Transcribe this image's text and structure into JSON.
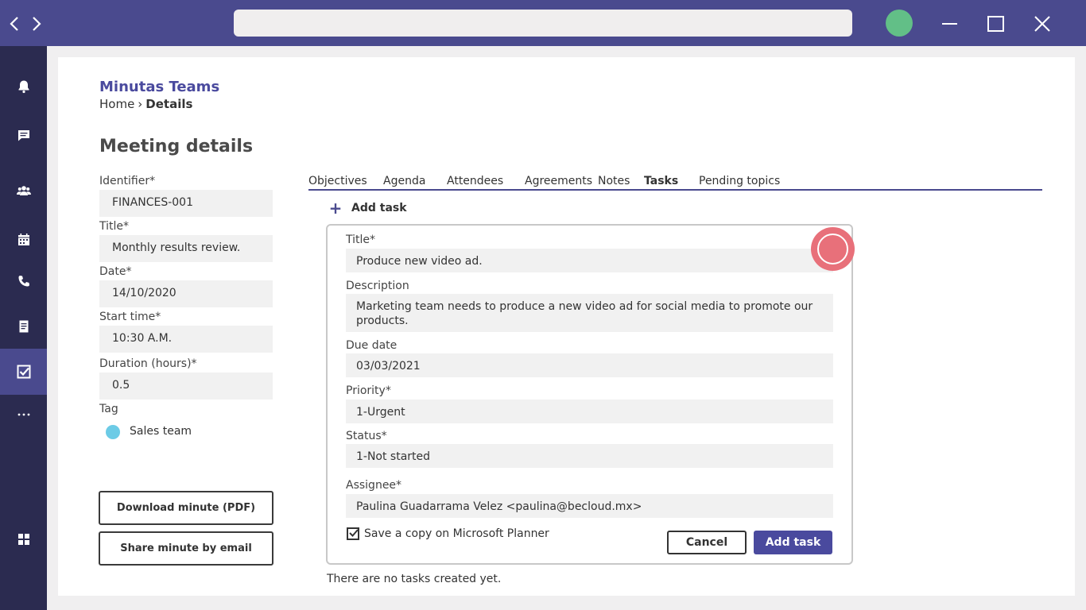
{
  "topbar": {
    "back_icon": "chevron-left-icon",
    "forward_icon": "chevron-right-icon",
    "address_value": "",
    "avatar_color": "#62bf87",
    "window_icons": [
      "minimize-icon",
      "maximize-icon",
      "close-icon"
    ]
  },
  "sidebar": {
    "items": [
      {
        "icon": "bell-icon",
        "active": false
      },
      {
        "icon": "chat-icon",
        "active": false
      },
      {
        "icon": "people-icon",
        "active": false
      },
      {
        "icon": "calendar-icon",
        "active": false
      },
      {
        "icon": "phone-icon",
        "active": false
      },
      {
        "icon": "document-icon",
        "active": false
      },
      {
        "icon": "tasks-check-icon",
        "active": true
      },
      {
        "icon": "more-icon",
        "active": false
      },
      {
        "icon": "apps-grid-icon",
        "active": false
      }
    ]
  },
  "header": {
    "app_title": "Minutas Teams",
    "breadcrumb": {
      "home": "Home",
      "separator": "›",
      "current": "Details"
    },
    "page_title": "Meeting details"
  },
  "meeting": {
    "identifier": {
      "label": "Identifier*",
      "value": "FINANCES-001"
    },
    "title": {
      "label": "Title*",
      "value": "Monthly results review."
    },
    "date": {
      "label": "Date*",
      "value": "14/10/2020"
    },
    "start_time": {
      "label": "Start time*",
      "value": "10:30 A.M."
    },
    "duration": {
      "label": "Duration (hours)*",
      "value": "0.5"
    },
    "tag": {
      "label": "Tag",
      "value": "Sales team",
      "color": "#6ccbe6"
    }
  },
  "actions": {
    "download": "Download minute (PDF)",
    "share": "Share minute by email"
  },
  "tabs": [
    {
      "label": "Objectives",
      "active": false
    },
    {
      "label": "Agenda",
      "active": false
    },
    {
      "label": "Attendees",
      "active": false
    },
    {
      "label": "Agreements",
      "active": false
    },
    {
      "label": "Notes",
      "active": false
    },
    {
      "label": "Tasks",
      "active": true
    },
    {
      "label": "Pending topics",
      "active": false
    }
  ],
  "tasks": {
    "add_link": {
      "icon": "+",
      "label": "Add task"
    },
    "form": {
      "title": {
        "label": "Title*",
        "value": "Produce new video ad."
      },
      "description": {
        "label": "Description",
        "value": "Marketing team needs to produce a new video ad for social media to promote our products."
      },
      "due_date": {
        "label": "Due date",
        "value": "03/03/2021"
      },
      "priority": {
        "label": "Priority*",
        "value": "1-Urgent"
      },
      "status": {
        "label": "Status*",
        "value": "1-Not started"
      },
      "assignee": {
        "label": "Assignee*",
        "value": "Paulina Guadarrama Velez <paulina@becloud.mx>"
      },
      "planner_copy": {
        "label": "Save a copy on Microsoft Planner",
        "checked": true
      },
      "cancel_label": "Cancel",
      "submit_label": "Add task"
    },
    "empty_message": "There are no tasks created yet."
  },
  "colors": {
    "primary": "#4a4a8e",
    "sidebar_bg": "#2b2b50",
    "accent_red": "#e8707a"
  }
}
